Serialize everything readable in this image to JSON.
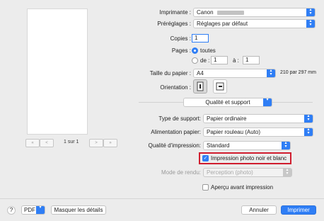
{
  "preview": {
    "page_indicator": "1 sur 1",
    "first": "«",
    "prev": "<",
    "next": ">",
    "last": "»"
  },
  "printer": {
    "label": "Imprimante :",
    "value": "Canon"
  },
  "presets": {
    "label": "Préréglages :",
    "value": "Réglages par défaut"
  },
  "copies": {
    "label": "Copies :",
    "value": "1"
  },
  "pages": {
    "label": "Pages :",
    "all": "toutes",
    "from_label": "de :",
    "from": "1",
    "to_label": "à :",
    "to": "1"
  },
  "paper_size": {
    "label": "Taille du papier :",
    "value": "A4",
    "dimensions": "210 par 297 mm"
  },
  "orientation": {
    "label": "Orientation :"
  },
  "section": {
    "value": "Qualité et support"
  },
  "media_type": {
    "label": "Type de support:",
    "value": "Papier ordinaire"
  },
  "paper_source": {
    "label": "Alimentation papier:",
    "value": "Papier rouleau (Auto)"
  },
  "quality": {
    "label": "Qualité d'impression:",
    "value": "Standard"
  },
  "bw_photo": {
    "label": "Impression photo noir et blanc",
    "checked": true
  },
  "render_mode": {
    "label": "Mode de rendu:",
    "value": "Perception (photo)"
  },
  "preview_check": {
    "label": "Aperçu avant impression"
  },
  "footer": {
    "help": "?",
    "pdf": "PDF",
    "hide_details": "Masquer les détails",
    "cancel": "Annuler",
    "print": "Imprimer"
  },
  "colors": {
    "accent": "#2f7ef5",
    "highlight": "#d01e2f"
  }
}
